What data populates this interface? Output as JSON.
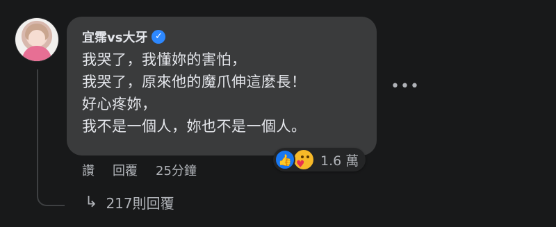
{
  "comment": {
    "author": "宜霈vs大牙",
    "lines": [
      "我哭了，我懂妳的害怕，",
      "我哭了，原來他的魔爪伸這麼長！",
      "好心疼妳，",
      "我不是一個人，妳也不是一個人。"
    ],
    "reaction_count": "1.6 萬",
    "actions": {
      "like_label": "讚",
      "reply_label": "回覆",
      "timestamp": "25分鐘"
    },
    "replies_label": "217則回覆"
  },
  "icons": {
    "verified": "verified-badge-icon",
    "more": "more-options-icon",
    "like": "like-reaction-icon",
    "care": "care-reaction-icon",
    "reply_arrow": "reply-arrow-icon"
  },
  "colors": {
    "background": "#18191a",
    "bubble": "#3a3b3c",
    "text": "#e4e6eb",
    "secondary_text": "#b0b3b8",
    "verified_blue": "#2d88ff",
    "like_blue": "#1877f2",
    "care_yellow": "#f7b928"
  }
}
